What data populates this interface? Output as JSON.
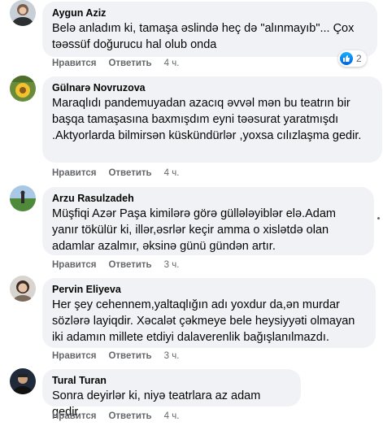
{
  "comments": [
    {
      "author": "Aygun Aziz",
      "text": "Belə anladım ki, tamaşa əslində heç də \"alınmayıb\"... Çox təəssüf doğurucu hal olub onda",
      "like": "Нравится",
      "reply": "Ответить",
      "time": "4 ч.",
      "reactions": "2"
    },
    {
      "author": "Gülnarə Novruzova",
      "text": "Maraqlıdı pandemuyadan azacıq əvvəl mən bu teatrın bir başqa tamaşasına baxmışdım eyni təəsurat yaratmışdı .Aktyorlarda bilmirsən küskündürlər ,yoxsa cılızlaşma gedir.",
      "like": "Нравится",
      "reply": "Ответить",
      "time": "4 ч."
    },
    {
      "author": "Arzu Rasulzadeh",
      "text": "Müşfiqi Azər Paşa kimilərə görə güllələyiblər elə.Adam yanır tökülür ki, illər,əsrlər keçir amma o xislətdə olan adamlar azalmır, əksinə günü gündən artır.",
      "like": "Нравится",
      "reply": "Ответить",
      "time": "3 ч."
    },
    {
      "author": "Pervin Eliyeva",
      "text": "Her şey cehennem,yaltaqlığın adı yoxdur da,ən murdar sözlərə layiqdir. Xəcalət çəkmeye bele heysiyyəti olmayan iki adamın millete etdiyi dalaverenlik bağışlanılmazdı.",
      "like": "Нравится",
      "reply": "Ответить",
      "time": "3 ч."
    },
    {
      "author": "Tural Turan",
      "text": "Sonra deyirlər ki, niyə teatrlara az adam gedir.",
      "like": "Нравится",
      "reply": "Ответить",
      "time": "4 ч."
    }
  ]
}
